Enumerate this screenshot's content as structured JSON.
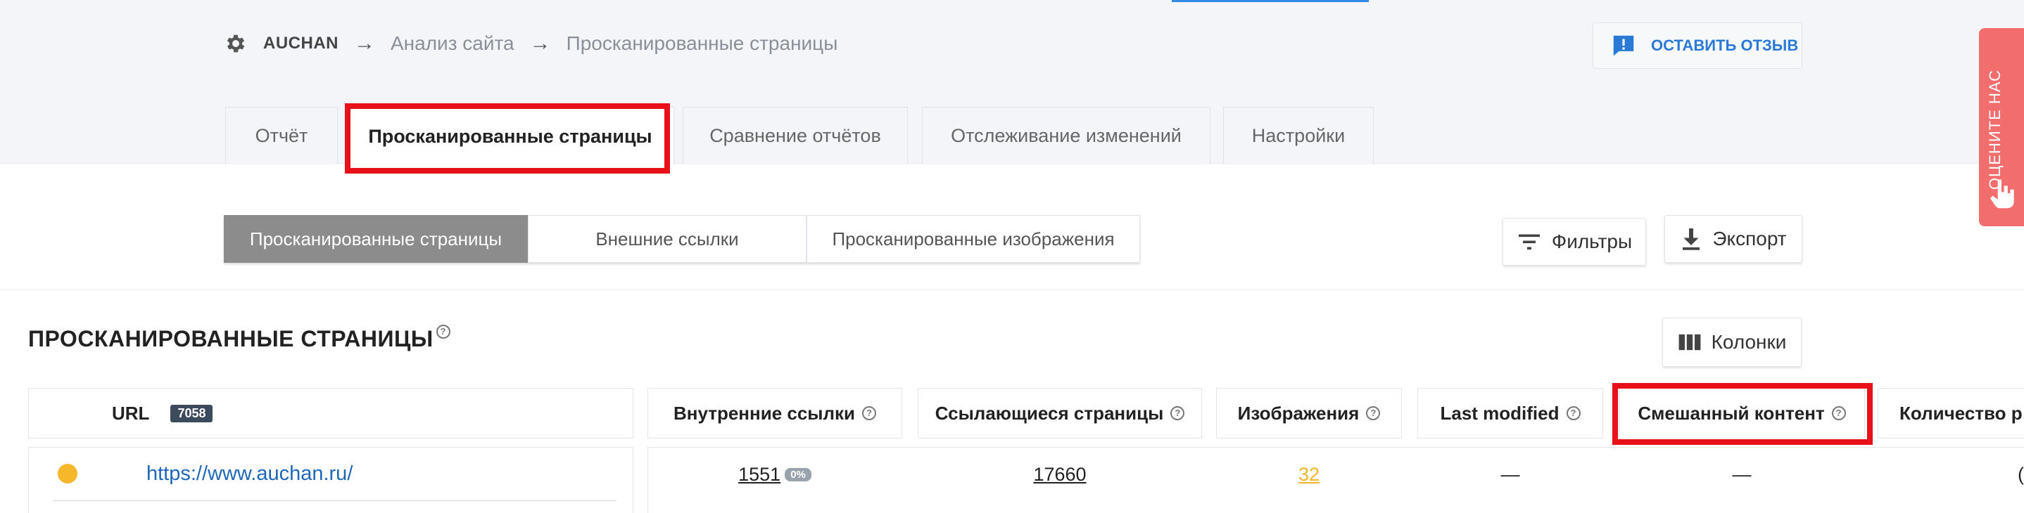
{
  "breadcrumb": {
    "root": "AUCHAN",
    "items": [
      "Анализ сайта",
      "Просканированные страницы"
    ]
  },
  "feedback_button": "ОСТАВИТЬ ОТЗЫВ",
  "rate_us": "ОЦЕНИТЕ НАС",
  "tabs": [
    "Отчёт",
    "Просканированные страницы",
    "Сравнение отчётов",
    "Отслеживание изменений",
    "Настройки"
  ],
  "active_tab": "Просканированные страницы",
  "subtabs": [
    "Просканированные страницы",
    "Внешние ссылки",
    "Просканированные изображения"
  ],
  "toolbar": {
    "filters": "Фильтры",
    "export": "Экспорт",
    "columns": "Колонки"
  },
  "section": {
    "title": "ПРОСКАНИРОВАННЫЕ СТРАНИЦЫ"
  },
  "table": {
    "url_header": "URL",
    "url_count": "7058",
    "columns": [
      "Внутренние ссылки",
      "Ссылающиеся страницы",
      "Изображения",
      "Last modified",
      "Смешанный контент",
      "Количество р"
    ],
    "rows": [
      {
        "url": "https://www.auchan.ru/",
        "internal_links": "1551",
        "internal_links_pct": "0%",
        "linking_pages": "17660",
        "images": "32",
        "last_modified": "—",
        "mixed_content": "—",
        "count": "("
      }
    ]
  },
  "colors": {
    "accent_blue": "#2a79d6",
    "highlight_red": "#e8111a",
    "status_dot": "#f6b72a",
    "images_value": "#f0b429",
    "rate_tab": "#f26d6d"
  }
}
